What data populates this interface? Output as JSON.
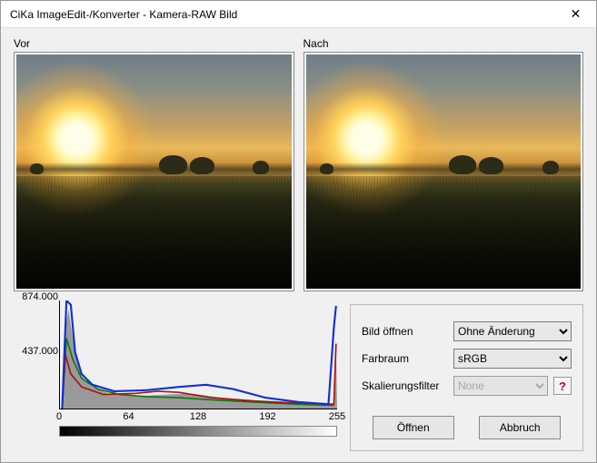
{
  "window": {
    "title": "CiKa ImageEdit-/Konverter - Kamera-RAW Bild",
    "close_symbol": "✕"
  },
  "preview": {
    "before_label": "Vor",
    "after_label": "Nach"
  },
  "histogram": {
    "y_max": "874.000",
    "y_mid": "437.000",
    "x_ticks": [
      "0",
      "64",
      "128",
      "192",
      "255"
    ]
  },
  "options": {
    "open_label": "Bild öffnen",
    "open_options": [
      "Ohne Änderung"
    ],
    "open_value": "Ohne Änderung",
    "colorspace_label": "Farbraum",
    "colorspace_options": [
      "sRGB"
    ],
    "colorspace_value": "sRGB",
    "scalefilter_label": "Skalierungsfilter",
    "scalefilter_options": [
      "None"
    ],
    "scalefilter_value": "None",
    "scalefilter_disabled": true,
    "help_symbol": "?",
    "open_button": "Öffnen",
    "cancel_button": "Abbruch"
  }
}
